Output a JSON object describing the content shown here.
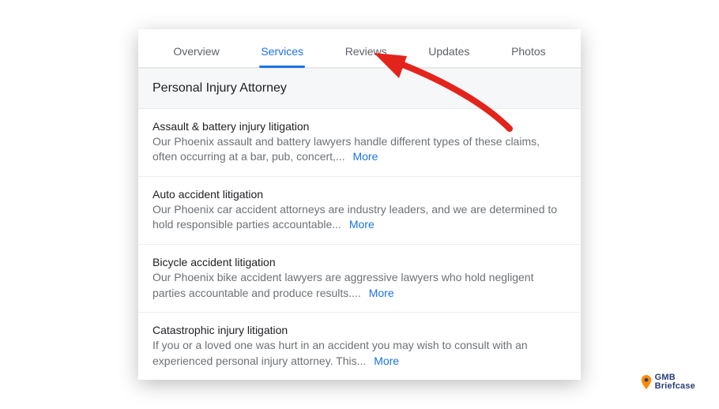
{
  "tabs": {
    "overview": "Overview",
    "services": "Services",
    "reviews": "Reviews",
    "updates": "Updates",
    "photos": "Photos",
    "activeIndex": 1
  },
  "section": {
    "heading": "Personal Injury Attorney"
  },
  "more_label": "More",
  "items": [
    {
      "title": "Assault & battery injury litigation",
      "desc": "Our Phoenix assault and battery lawyers handle different types of these claims, often occurring at a bar, pub, concert,..."
    },
    {
      "title": "Auto accident litigation",
      "desc": "Our Phoenix car accident attorneys are industry leaders, and we are determined to hold responsible parties accountable..."
    },
    {
      "title": "Bicycle accident litigation",
      "desc": "Our Phoenix bike accident lawyers are aggressive lawyers who hold negligent parties accountable and produce results...."
    },
    {
      "title": "Catastrophic injury litigation",
      "desc": "If you or a loved one was hurt in an accident you may wish to consult with an experienced personal injury attorney. This..."
    }
  ],
  "brand": {
    "line1": "GMB",
    "line2": "Briefcase"
  },
  "annotation": {
    "arrow_color": "#e3241d"
  }
}
